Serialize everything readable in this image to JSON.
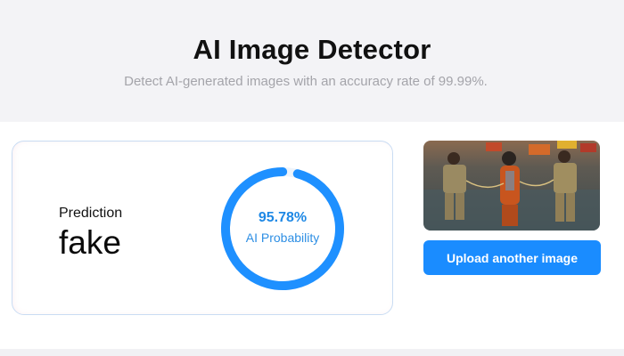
{
  "header": {
    "title": "AI Image Detector",
    "subtitle": "Detect AI-generated images with an accuracy rate of 99.99%."
  },
  "result": {
    "prediction_label": "Prediction",
    "prediction_value": "fake",
    "probability_text": "95.78%",
    "probability_fraction": 0.9578,
    "probability_label": "AI Probability"
  },
  "upload": {
    "button_label": "Upload another image"
  },
  "colors": {
    "accent": "#1a8cff",
    "gauge": "#1e90ff",
    "card_border": "#c9dcf3"
  }
}
